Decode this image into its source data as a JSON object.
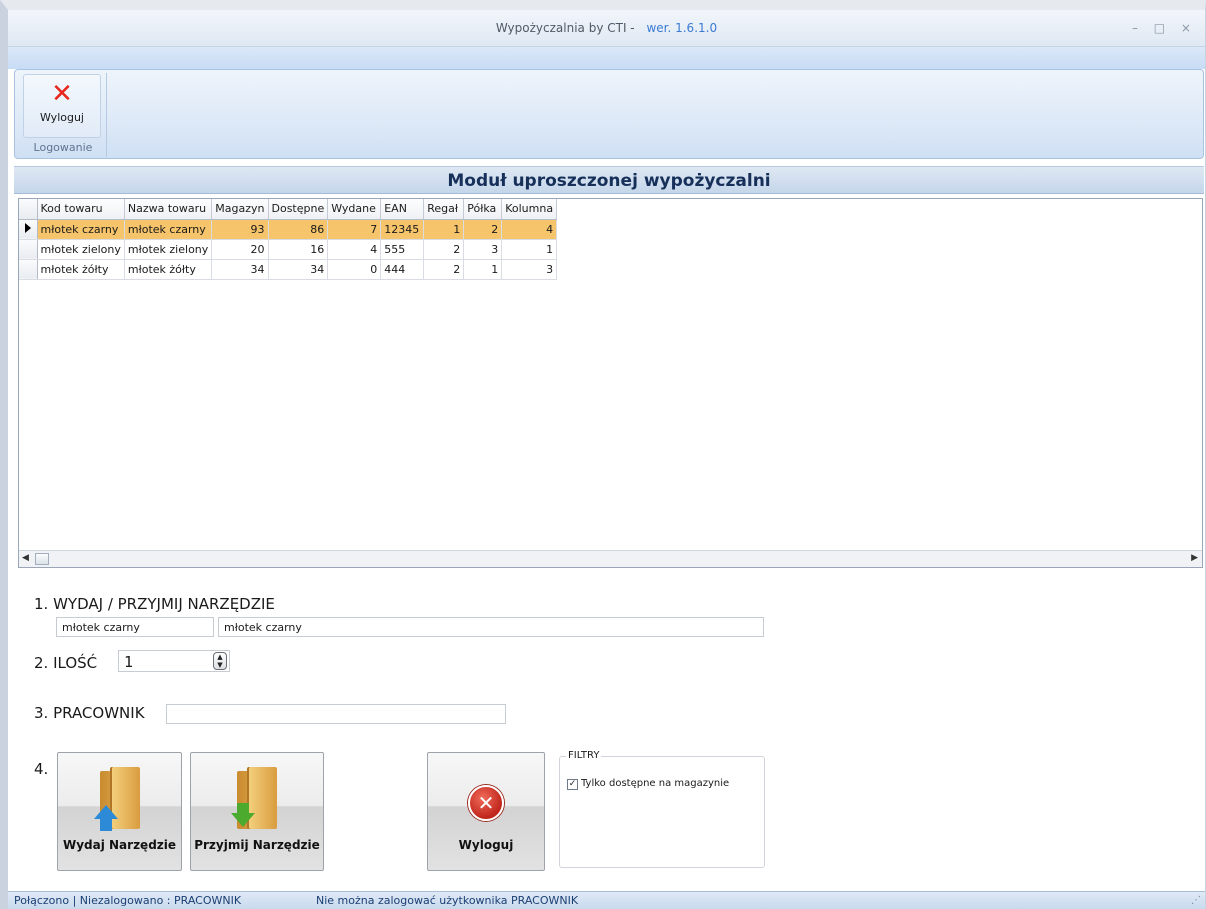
{
  "window": {
    "title": "Wypożyczalnia by CTI -",
    "version": "wer. 1.6.1.0",
    "controls": "– □ ×"
  },
  "ribbon": {
    "logout_label": "Wyloguj",
    "group_label": "Logowanie"
  },
  "module_title": "Moduł uproszczonej wypożyczalni",
  "grid": {
    "columns": [
      "Kod towaru",
      "Nazwa towaru",
      "Magazyn",
      "Dostępne",
      "Wydane",
      "EAN",
      "Regał",
      "Półka",
      "Kolumna"
    ],
    "rows": [
      [
        "młotek czarny",
        "młotek czarny",
        "93",
        "86",
        "7",
        "12345",
        "1",
        "2",
        "4"
      ],
      [
        "młotek zielony",
        "młotek zielony",
        "20",
        "16",
        "4",
        "555",
        "2",
        "3",
        "1"
      ],
      [
        "młotek żółty",
        "młotek żółty",
        "34",
        "34",
        "0",
        "444",
        "2",
        "1",
        "3"
      ]
    ],
    "selected_row": 0
  },
  "form": {
    "step1_label": "1. WYDAJ / PRZYJMIJ NARZĘDZIE",
    "tool_code": "młotek czarny",
    "tool_name": "młotek czarny",
    "step2_label": "2. ILOŚĆ",
    "quantity": "1",
    "step3_label": "3. PRACOWNIK",
    "employee": "",
    "step4_label": "4."
  },
  "buttons": {
    "issue": "Wydaj Narzędzie",
    "receive": "Przyjmij Narzędzie",
    "logout": "Wyloguj"
  },
  "filters": {
    "legend": "FILTRY",
    "only_available_label": "Tylko dostępne na magazynie",
    "only_available_checked": true
  },
  "status": {
    "connection": "Połączono | Niezalogowano : PRACOWNIK",
    "message": "Nie można zalogować użytkownika PRACOWNIK"
  },
  "colors": {
    "selected_row": "#f6c46a",
    "logout_icon": "#e8261d",
    "header_text": "#16305a"
  }
}
